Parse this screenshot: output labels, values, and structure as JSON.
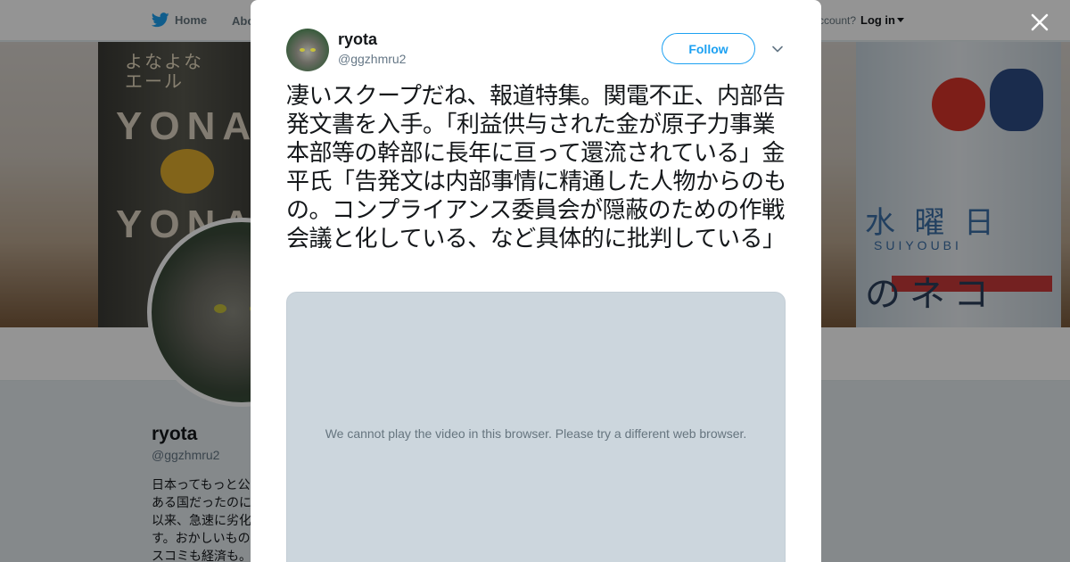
{
  "nav": {
    "home_label": "Home",
    "about_label": "Abo",
    "account_prompt": "ccount?",
    "login_label": "Log in"
  },
  "banner": {
    "left_can_top": "よなよな\nエール",
    "left_can_word1": "YONA",
    "left_can_word2": "YONA",
    "right_can_kanji": "水 曜 日",
    "right_can_roman": "SUIYOUBI",
    "right_can_word": "のネコ"
  },
  "profile": {
    "name": "ryota",
    "handle": "@ggzhmru2",
    "bio": "日本ってもっと公\nある国だったのに\n以来、急速に劣化\nす。おかしいもの\nスコミも経済も。"
  },
  "modal": {
    "close_icon": "close-icon",
    "tweet": {
      "author_name": "ryota",
      "author_handle": "@ggzhmru2",
      "follow_label": "Follow",
      "text": "凄いスクープだね、報道特集。関電不正、内部告発文書を入手。「利益供与された金が原子力事業本部等の幹部に長年に亘って還流されている」金平氏「告発文は内部事情に精通した人物からのもの。コンプライアンス委員会が隠蔽のための作戦会議と化している、など具体的に批判している」",
      "media_message": "We cannot play the video in this browser. Please try a different web browser."
    }
  },
  "colors": {
    "brand_blue": "#1da1f2",
    "overlay": "rgba(0,0,0,0.42)",
    "media_bg": "#ccd6dd"
  }
}
